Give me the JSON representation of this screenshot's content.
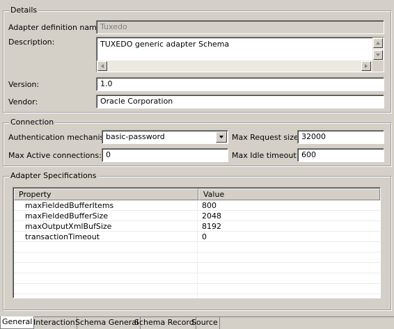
{
  "details": {
    "title": "Details",
    "adapter_definition_name": {
      "label": "Adapter definition name:",
      "value": "Tuxedo"
    },
    "description": {
      "label": "Description:",
      "value": "TUXEDO generic adapter Schema"
    },
    "version": {
      "label": "Version:",
      "value": "1.0"
    },
    "vendor": {
      "label": "Vendor:",
      "value": "Oracle Corporation"
    }
  },
  "connection": {
    "title": "Connection",
    "auth_mechanism": {
      "label": "Authentication mechanism:",
      "value": "basic-password"
    },
    "max_request_size": {
      "label": "Max Request size:",
      "value": "32000"
    },
    "max_active_connections": {
      "label": "Max Active connections:",
      "value": "0"
    },
    "max_idle_timeout": {
      "label": "Max Idle timeout:",
      "value": "600"
    }
  },
  "adapter_specs": {
    "title": "Adapter Specifications",
    "columns": [
      "Property",
      "Value"
    ],
    "rows": [
      {
        "property": "maxFieldedBufferItems",
        "value": "800"
      },
      {
        "property": "maxFieldedBufferSize",
        "value": "2048"
      },
      {
        "property": "maxOutputXmlBufSize",
        "value": "8192"
      },
      {
        "property": "transactionTimeout",
        "value": "0"
      }
    ],
    "empty_rows": 7
  },
  "tabs": [
    {
      "label": "General",
      "active": true
    },
    {
      "label": "Interaction",
      "active": false
    },
    {
      "label": "Schema General",
      "active": false
    },
    {
      "label": "Schema Record",
      "active": false
    },
    {
      "label": "Source",
      "active": false
    }
  ],
  "colors": {
    "window_bg": "#d4d0c8",
    "field_bg": "#ffffff",
    "disabled_text": "#808080"
  }
}
